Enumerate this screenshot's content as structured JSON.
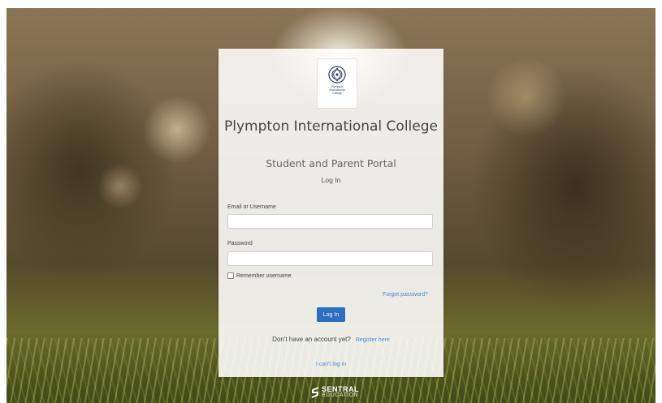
{
  "logo": {
    "text_lines": [
      "Plympton",
      "International",
      "College"
    ]
  },
  "school_name": "Plympton International College",
  "portal_title": "Student and Parent Portal",
  "login_heading": "Log In",
  "form": {
    "email_label": "Email or Username",
    "email_value": "",
    "password_label": "Password",
    "password_value": "",
    "remember_label": "Remember username",
    "remember_checked": false,
    "forgot_link": "Forgot password?",
    "login_button": "Log In"
  },
  "register": {
    "prompt": "Don't have an account yet?",
    "link": "Register here"
  },
  "cant_login_link": "I can't log in",
  "footer": {
    "brand_line1": "SENTRAL",
    "brand_line2": "EDUCATION"
  },
  "colors": {
    "accent": "#2c6ebf",
    "link": "#4a8ad4"
  }
}
